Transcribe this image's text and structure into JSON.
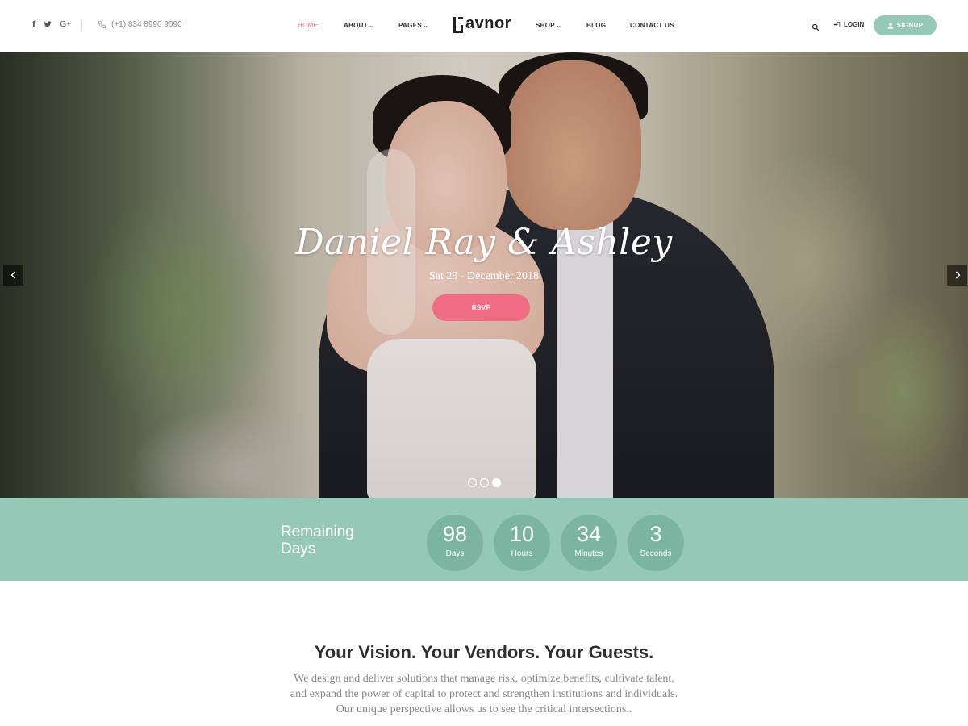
{
  "header": {
    "social": [
      {
        "icon": "facebook-icon",
        "glyph": "f"
      },
      {
        "icon": "twitter-icon",
        "glyph": ""
      },
      {
        "icon": "google-plus-icon",
        "glyph": "G+"
      }
    ],
    "phone": "(+1) 834 8990 9090",
    "nav": [
      {
        "label": "HOME",
        "active": true,
        "dropdown": false
      },
      {
        "label": "ABOUT",
        "active": false,
        "dropdown": true
      },
      {
        "label": "PAGES",
        "active": false,
        "dropdown": true
      },
      {
        "label": "SHOP",
        "active": false,
        "dropdown": true
      },
      {
        "label": "BLOG",
        "active": false,
        "dropdown": false
      },
      {
        "label": "CONTACT US",
        "active": false,
        "dropdown": false
      }
    ],
    "logo": "avnor",
    "login_label": "LOGIN",
    "signup_label": "SIGNUP"
  },
  "hero": {
    "title": "Daniel Ray & Ashley",
    "date": "Sat 29 - December 2018",
    "rsvp_label": "RSVP",
    "prev_glyph": "‹",
    "next_glyph": "›",
    "slides": 3,
    "active_slide": 3
  },
  "countdown": {
    "heading_line1": "Remaining",
    "heading_line2": "Days",
    "items": [
      {
        "value": "98",
        "label": "Days"
      },
      {
        "value": "10",
        "label": "Hours"
      },
      {
        "value": "34",
        "label": "Minutes"
      },
      {
        "value": "3",
        "label": "Seconds"
      }
    ]
  },
  "intro": {
    "title": "Your Vision. Your Vendors. Your Guests.",
    "text": "We design and deliver solutions that manage risk, optimize benefits, cultivate talent, and expand the power of capital to protect and strengthen institutions and individuals. Our unique perspective allows us to see the critical intersections.."
  },
  "colors": {
    "accent_pink": "#f06c84",
    "mint": "#96c8b7",
    "mint_dark": "#7bb5a2"
  }
}
